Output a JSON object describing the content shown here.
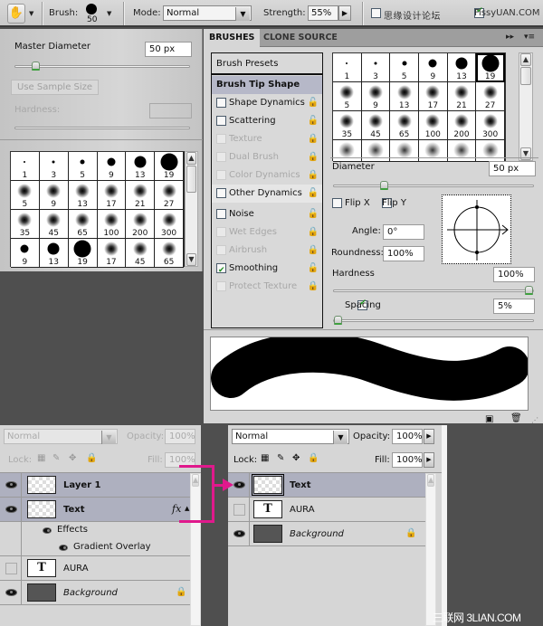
{
  "options_bar": {
    "tool_icon": "brush-tool-icon",
    "brush_label": "Brush:",
    "brush_size": "50",
    "mode_label": "Mode:",
    "mode_value": "Normal",
    "strength_label": "Strength:",
    "strength_value": "55%",
    "sample_all_layers_label": "思缘设计论坛",
    "finger_painting_label": "FissyUAN.COM",
    "sample_all_layers_checked": false,
    "finger_painting_checked": true
  },
  "brush_popup": {
    "master_diameter_label": "Master Diameter",
    "master_diameter_value": "50 px",
    "master_diameter_fraction": 0.1,
    "use_sample_size_label": "Use Sample Size",
    "hardness_label": "Hardness:",
    "hardness_value": "",
    "brushes": [
      {
        "size": "1",
        "kind": "hard"
      },
      {
        "size": "3",
        "kind": "hard"
      },
      {
        "size": "5",
        "kind": "hard"
      },
      {
        "size": "9",
        "kind": "hard"
      },
      {
        "size": "13",
        "kind": "hard"
      },
      {
        "size": "19",
        "kind": "hard"
      },
      {
        "size": "5",
        "kind": "soft"
      },
      {
        "size": "9",
        "kind": "soft"
      },
      {
        "size": "13",
        "kind": "soft"
      },
      {
        "size": "17",
        "kind": "soft"
      },
      {
        "size": "21",
        "kind": "soft"
      },
      {
        "size": "27",
        "kind": "soft"
      },
      {
        "size": "35",
        "kind": "soft"
      },
      {
        "size": "45",
        "kind": "soft"
      },
      {
        "size": "65",
        "kind": "soft"
      },
      {
        "size": "100",
        "kind": "soft"
      },
      {
        "size": "200",
        "kind": "soft"
      },
      {
        "size": "300",
        "kind": "soft"
      },
      {
        "size": "9",
        "kind": "hard"
      },
      {
        "size": "13",
        "kind": "hard"
      },
      {
        "size": "19",
        "kind": "hard"
      },
      {
        "size": "17",
        "kind": "soft"
      },
      {
        "size": "45",
        "kind": "soft"
      },
      {
        "size": "65",
        "kind": "soft"
      }
    ]
  },
  "brushes_panel": {
    "tabs": [
      "BRUSHES",
      "CLONE SOURCE"
    ],
    "active_tab": "BRUSHES",
    "options": [
      {
        "label": "Brush Presets",
        "type": "header"
      },
      {
        "label": "Brush Tip Shape",
        "type": "selected"
      },
      {
        "label": "Shape Dynamics",
        "checked": false,
        "enabled": true
      },
      {
        "label": "Scattering",
        "checked": false,
        "enabled": true
      },
      {
        "label": "Texture",
        "checked": false,
        "enabled": false
      },
      {
        "label": "Dual Brush",
        "checked": false,
        "enabled": false
      },
      {
        "label": "Color Dynamics",
        "checked": false,
        "enabled": false
      },
      {
        "label": "Other Dynamics",
        "checked": false,
        "enabled": true
      },
      {
        "label": "Noise",
        "checked": false,
        "enabled": true
      },
      {
        "label": "Wet Edges",
        "checked": false,
        "enabled": false
      },
      {
        "label": "Airbrush",
        "checked": false,
        "enabled": false
      },
      {
        "label": "Smoothing",
        "checked": true,
        "enabled": true
      },
      {
        "label": "Protect Texture",
        "checked": false,
        "enabled": false
      }
    ],
    "tips": [
      {
        "size": "1",
        "kind": "hard"
      },
      {
        "size": "3",
        "kind": "hard"
      },
      {
        "size": "5",
        "kind": "hard"
      },
      {
        "size": "9",
        "kind": "hard"
      },
      {
        "size": "13",
        "kind": "hard"
      },
      {
        "size": "19",
        "kind": "hard",
        "selected": true
      },
      {
        "size": "5",
        "kind": "soft"
      },
      {
        "size": "9",
        "kind": "soft"
      },
      {
        "size": "13",
        "kind": "soft"
      },
      {
        "size": "17",
        "kind": "soft"
      },
      {
        "size": "21",
        "kind": "soft"
      },
      {
        "size": "27",
        "kind": "soft"
      },
      {
        "size": "35",
        "kind": "soft"
      },
      {
        "size": "45",
        "kind": "soft"
      },
      {
        "size": "65",
        "kind": "soft"
      },
      {
        "size": "100",
        "kind": "soft"
      },
      {
        "size": "200",
        "kind": "soft"
      },
      {
        "size": "300",
        "kind": "soft"
      },
      {
        "size": "",
        "kind": "scatter"
      },
      {
        "size": "",
        "kind": "scatter"
      },
      {
        "size": "",
        "kind": "scatter"
      },
      {
        "size": "",
        "kind": "scatter"
      },
      {
        "size": "",
        "kind": "scatter"
      },
      {
        "size": "",
        "kind": "scatter"
      }
    ],
    "diameter_label": "Diameter",
    "diameter_value": "50 px",
    "diameter_fraction": 0.24,
    "flip_x_label": "Flip X",
    "flip_y_label": "Flip Y",
    "angle_label": "Angle:",
    "angle_value": "0°",
    "roundness_label": "Roundness:",
    "roundness_value": "100%",
    "hardness_label": "Hardness",
    "hardness_value": "100%",
    "hardness_fraction": 1.0,
    "spacing_label": "Spacing",
    "spacing_checked": true,
    "spacing_value": "5%",
    "spacing_fraction": 0.0
  },
  "layers_left": {
    "blend_mode": "Normal",
    "opacity_label": "Opacity:",
    "opacity_value": "100%",
    "lock_label": "Lock:",
    "fill_label": "Fill:",
    "fill_value": "100%",
    "layers": [
      {
        "name": "Layer 1",
        "visible": true,
        "selected": true,
        "thumb": "checker"
      },
      {
        "name": "Text",
        "visible": true,
        "selected": true,
        "thumb": "checker-text",
        "fx": "fx"
      },
      {
        "name": "Effects",
        "sub": true
      },
      {
        "name": "Gradient Overlay",
        "sub": true
      },
      {
        "name": "AURA",
        "visible": false,
        "thumb": "type"
      },
      {
        "name": "Background",
        "visible": true,
        "thumb": "dark",
        "locked": true
      }
    ]
  },
  "layers_right": {
    "blend_mode": "Normal",
    "opacity_label": "Opacity:",
    "opacity_value": "100%",
    "lock_label": "Lock:",
    "fill_label": "Fill:",
    "fill_value": "100%",
    "layers": [
      {
        "name": "Text",
        "visible": true,
        "selected": true,
        "thumb": "checker-text"
      },
      {
        "name": "AURA",
        "visible": false,
        "thumb": "type"
      },
      {
        "name": "Background",
        "visible": true,
        "thumb": "dark",
        "locked": true
      }
    ]
  },
  "type_glyph": "T",
  "watermark": "三联网 3LIAN.COM",
  "colors": {
    "annotation_arrow": "#e0198c",
    "panel_bg": "#d6d6d6",
    "selected_layer": "#aeb0bf",
    "workspace": "#4f4f4f"
  }
}
